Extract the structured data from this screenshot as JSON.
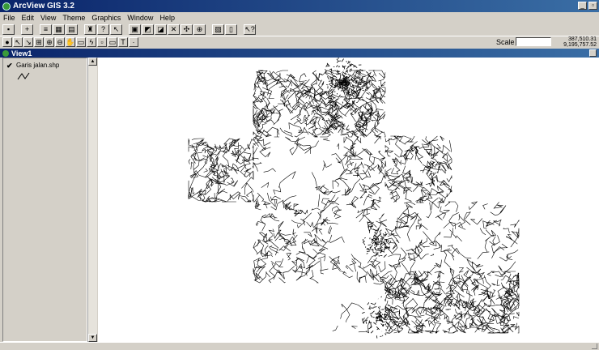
{
  "app": {
    "title": "ArcView GIS 3.2",
    "min_glyph": "_",
    "restore_glyph": "▫"
  },
  "menu": [
    "File",
    "Edit",
    "View",
    "Theme",
    "Graphics",
    "Window",
    "Help"
  ],
  "toolbar1": {
    "buttons": [
      "save-icon",
      "add-theme-icon",
      "properties-icon",
      "table-icon",
      "layout-icon",
      "find-icon",
      "query-icon",
      "select-icon",
      "zoom-full-icon",
      "zoom-active-icon",
      "zoom-selected-icon",
      "zoom-in-fixed-icon",
      "zoom-out-fixed-icon",
      "zoom-previous-icon",
      "legend-icon",
      "table-view-icon",
      "help-icon"
    ]
  },
  "toolbar2": {
    "buttons": [
      "identify-icon",
      "pointer-icon",
      "vertex-edit-icon",
      "zoom-in-icon",
      "zoom-out-icon",
      "zoom-out-icon",
      "pan-icon",
      "measure-icon",
      "hotlink-icon",
      "area-select-icon",
      "label-icon",
      "text-icon",
      "draw-dropdown-icon"
    ],
    "scale_label": "Scale 1:",
    "scale_value": "",
    "coord_x": "387,510.31",
    "coord_y": "9,195,757.52"
  },
  "view": {
    "title": "View1"
  },
  "toc": {
    "layers": [
      {
        "name": "Garis jalan.shp",
        "visible": true,
        "check_glyph": "✔"
      }
    ]
  },
  "map": {
    "line_color": "#000000",
    "background": "#ffffff"
  }
}
